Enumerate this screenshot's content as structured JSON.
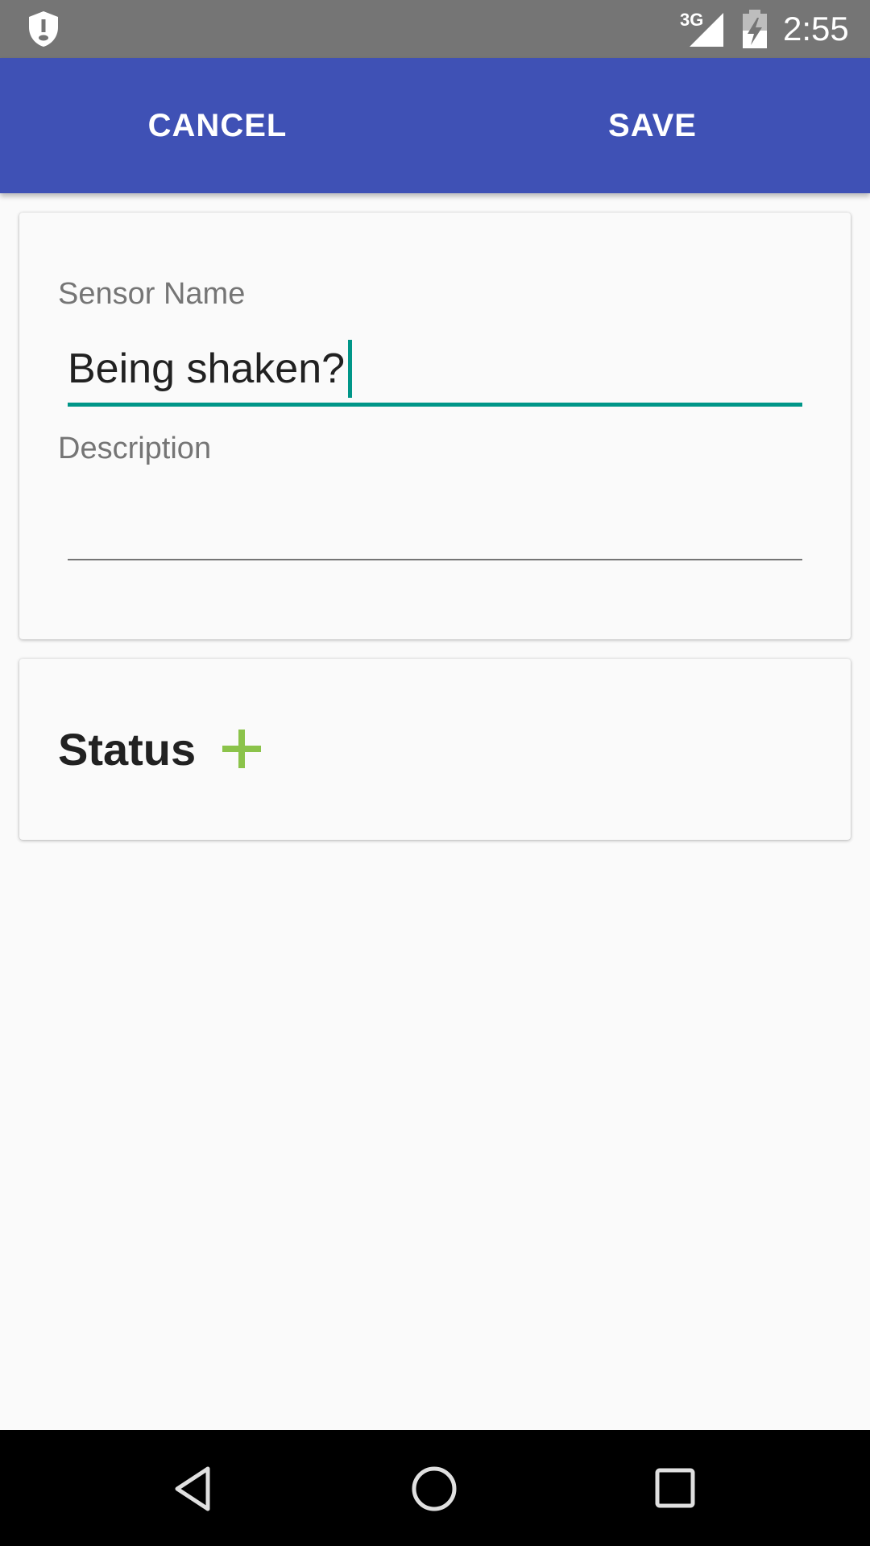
{
  "status_bar": {
    "time": "2:55",
    "network": "3G",
    "icons": [
      "shield-alert-icon",
      "signal-icon",
      "battery-charging-icon"
    ]
  },
  "toolbar": {
    "cancel_label": "CANCEL",
    "save_label": "SAVE",
    "color": "#3f51b5"
  },
  "form": {
    "sensor_name_label": "Sensor Name",
    "sensor_name_value": "Being shaken?",
    "description_label": "Description",
    "description_value": "",
    "accent_color": "#009688"
  },
  "status_section": {
    "title": "Status",
    "add_icon": "plus-icon",
    "add_color": "#8bc34a"
  },
  "nav_bar": {
    "icons": [
      "back-icon",
      "home-icon",
      "recents-icon"
    ]
  }
}
